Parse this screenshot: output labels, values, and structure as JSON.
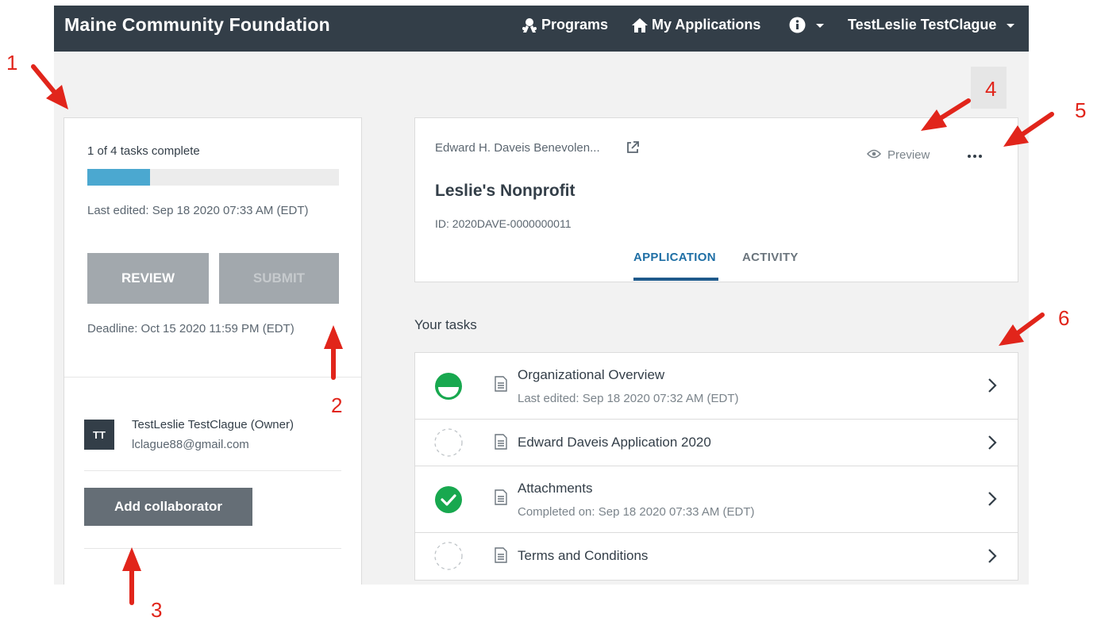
{
  "colors": {
    "nav_bg": "#333e48",
    "progress_fill": "#4ba8d0",
    "tab_active": "#1f6fa5",
    "task_complete": "#18a84f",
    "annotation_red": "#e1251b"
  },
  "topbar": {
    "brand": "Maine Community Foundation",
    "nav": [
      {
        "label": "Programs",
        "icon": "award-ribbon-icon"
      },
      {
        "label": "My Applications",
        "icon": "home-icon"
      },
      {
        "label": "",
        "icon": "info-circle-icon"
      },
      {
        "label": "TestLeslie TestClague",
        "icon": "chevron-down-icon"
      }
    ]
  },
  "sidebar": {
    "tasks_complete_text": "1 of 4 tasks complete",
    "progress_fraction": 0.25,
    "last_edited": "Last edited: Sep 18 2020 07:33 AM (EDT)",
    "review_label": "REVIEW",
    "submit_label": "SUBMIT",
    "deadline": "Deadline: Oct 15 2020 11:59 PM (EDT)",
    "owner_initials": "TT",
    "owner_name": "TestLeslie TestClague (Owner)",
    "owner_email": "lclague88@gmail.com",
    "add_collaborator_label": "Add collaborator"
  },
  "header": {
    "program_name": "Edward H. Daveis Benevolen...",
    "preview_label": "Preview",
    "org_name": "Leslie's Nonprofit",
    "id_label": "ID:",
    "id_value": "2020DAVE-0000000011",
    "tabs": [
      {
        "label": "APPLICATION",
        "active": true
      },
      {
        "label": "ACTIVITY",
        "active": false
      }
    ]
  },
  "tasks": {
    "heading": "Your tasks",
    "items": [
      {
        "title": "Organizational Overview",
        "subtitle": "Last edited: Sep 18 2020 07:32 AM (EDT)",
        "status": "in-progress"
      },
      {
        "title": "Edward Daveis Application 2020",
        "subtitle": "",
        "status": "not-started"
      },
      {
        "title": "Attachments",
        "subtitle": "Completed on: Sep 18 2020 07:33 AM (EDT)",
        "status": "complete"
      },
      {
        "title": "Terms and Conditions",
        "subtitle": "",
        "status": "not-started"
      }
    ]
  },
  "annotations": [
    "1",
    "2",
    "3",
    "4",
    "5",
    "6"
  ]
}
